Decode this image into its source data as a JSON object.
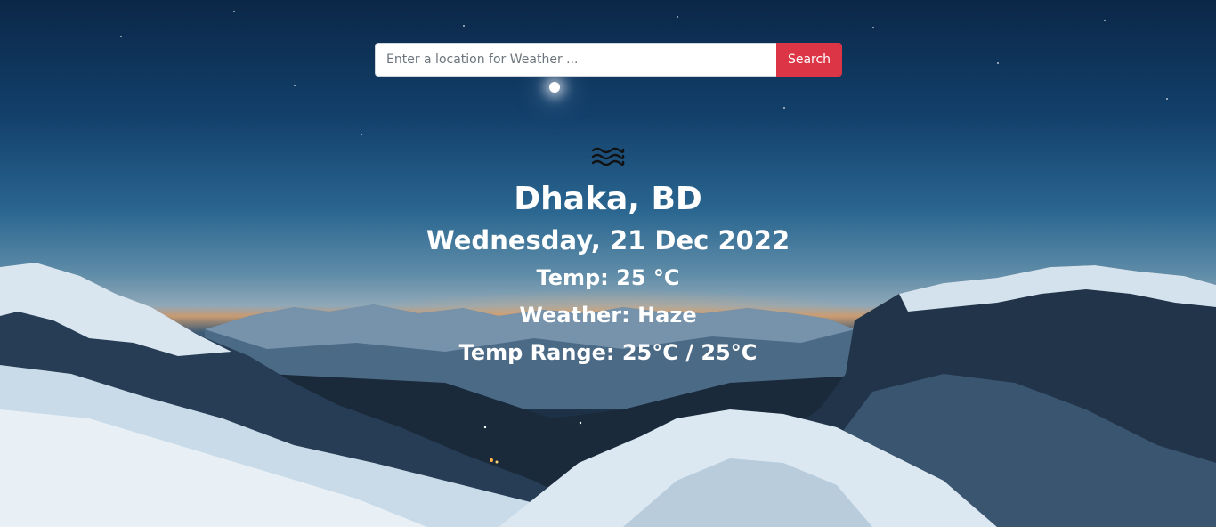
{
  "search": {
    "placeholder": "Enter a location for Weather ...",
    "value": "",
    "button_label": "Search"
  },
  "weather": {
    "icon": "haze-icon",
    "city": "Dhaka, BD",
    "date": "Wednesday, 21 Dec 2022",
    "temp": "Temp: 25 °C",
    "condition": "Weather: Haze",
    "temp_range": "Temp Range: 25°C / 25°C"
  },
  "colors": {
    "search_button": "#dc3545",
    "text": "#ffffff"
  }
}
